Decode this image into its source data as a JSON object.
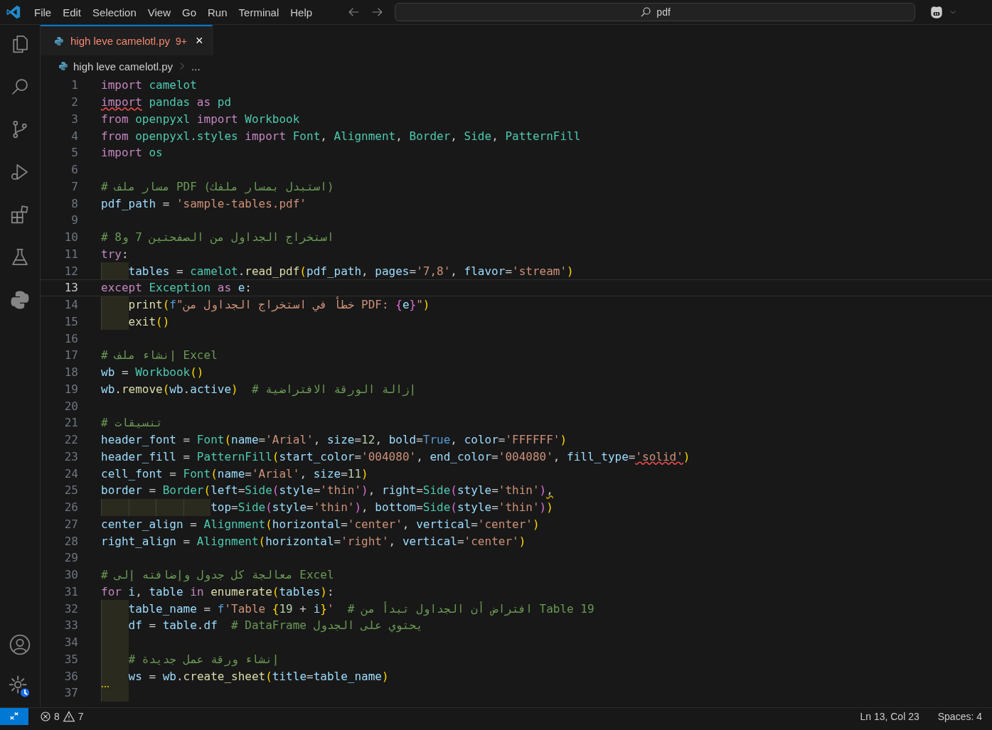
{
  "menu": [
    "File",
    "Edit",
    "Selection",
    "View",
    "Go",
    "Run",
    "Terminal",
    "Help"
  ],
  "search": {
    "value": "pdf"
  },
  "tabs": [
    {
      "label": "high leve camelotl.py",
      "problems": "9+",
      "close": "×",
      "selected": true,
      "has_errors": true
    }
  ],
  "breadcrumb": {
    "file": "high leve camelotl.py",
    "more": "..."
  },
  "lines": [
    {
      "number": "1",
      "current": false,
      "tokens": [
        {
          "kind": "kw",
          "text": "import"
        },
        {
          "kind": "mod",
          "text": " camelot"
        }
      ]
    },
    {
      "number": "2",
      "current": false,
      "tokens": [
        {
          "kind": "kw",
          "text": "import",
          "error": true
        },
        {
          "kind": "mod",
          "text": " pandas"
        },
        {
          "kind": "kw",
          "text": " as"
        },
        {
          "kind": "mod",
          "text": " pd"
        }
      ]
    },
    {
      "number": "3",
      "current": false,
      "tokens": [
        {
          "kind": "kw",
          "text": "from"
        },
        {
          "kind": "mod",
          "text": " openpyxl"
        },
        {
          "kind": "kw",
          "text": " import"
        },
        {
          "kind": "mod",
          "text": " Workbook"
        }
      ]
    },
    {
      "number": "4",
      "current": false,
      "tokens": [
        {
          "kind": "kw",
          "text": "from"
        },
        {
          "kind": "mod",
          "text": " openpyxl.styles"
        },
        {
          "kind": "kw",
          "text": " import"
        },
        {
          "kind": "mod",
          "text": " Font"
        },
        {
          "kind": "op",
          "text": ","
        },
        {
          "kind": "mod",
          "text": " Alignment"
        },
        {
          "kind": "op",
          "text": ","
        },
        {
          "kind": "mod",
          "text": " Border"
        },
        {
          "kind": "op",
          "text": ","
        },
        {
          "kind": "mod",
          "text": " Side"
        },
        {
          "kind": "op",
          "text": ","
        },
        {
          "kind": "mod",
          "text": " PatternFill"
        }
      ]
    },
    {
      "number": "5",
      "current": false,
      "tokens": [
        {
          "kind": "kw",
          "text": "import"
        },
        {
          "kind": "mod",
          "text": " os"
        }
      ]
    },
    {
      "number": "6",
      "current": false
    },
    {
      "number": "7",
      "current": false,
      "tokens": [
        {
          "kind": "cmt",
          "text": "# مسار ملف PDF (استبدل بمسار ملفك)"
        }
      ]
    },
    {
      "number": "8",
      "current": false,
      "tokens": [
        {
          "kind": "var",
          "text": "pdf_path"
        },
        {
          "kind": "op",
          "text": " ="
        },
        {
          "kind": "str",
          "text": " 'sample-tables.pdf'"
        }
      ]
    },
    {
      "number": "9",
      "current": false
    },
    {
      "number": "10",
      "current": false,
      "tokens": [
        {
          "kind": "cmt",
          "text": "# استخراج الجداول من الصفحتين 7 و8"
        }
      ]
    },
    {
      "number": "11",
      "current": false,
      "tokens": [
        {
          "kind": "kw",
          "text": "try"
        },
        {
          "kind": "op",
          "text": ":"
        }
      ]
    },
    {
      "number": "12",
      "current": false,
      "tokens": [
        {
          "kind": "indent"
        },
        {
          "kind": "var",
          "text": "tables"
        },
        {
          "kind": "op",
          "text": " ="
        },
        {
          "kind": "mod",
          "text": " camelot"
        },
        {
          "kind": "op",
          "text": "."
        },
        {
          "kind": "fn",
          "text": "read_pdf"
        },
        {
          "kind": "br1",
          "text": "("
        },
        {
          "kind": "var",
          "text": "pdf_path"
        },
        {
          "kind": "op",
          "text": ","
        },
        {
          "kind": "var",
          "text": " pages"
        },
        {
          "kind": "op",
          "text": "="
        },
        {
          "kind": "str",
          "text": "'7,8'"
        },
        {
          "kind": "op",
          "text": ","
        },
        {
          "kind": "var",
          "text": " flavor"
        },
        {
          "kind": "op",
          "text": "="
        },
        {
          "kind": "str",
          "text": "'stream'"
        },
        {
          "kind": "br1",
          "text": ")"
        }
      ]
    },
    {
      "number": "13",
      "current": true,
      "tokens": [
        {
          "kind": "kw",
          "text": "except"
        },
        {
          "kind": "mod",
          "text": " Exception"
        },
        {
          "kind": "kw",
          "text": " as"
        },
        {
          "kind": "var",
          "text": " e"
        },
        {
          "kind": "op",
          "text": ":"
        }
      ]
    },
    {
      "number": "14",
      "current": false,
      "tokens": [
        {
          "kind": "indent"
        },
        {
          "kind": "fn",
          "text": "print"
        },
        {
          "kind": "br1",
          "text": "("
        },
        {
          "kind": "const",
          "text": "f"
        },
        {
          "kind": "str",
          "text": "\"خطأ في استخراج الجداول من PDF: "
        },
        {
          "kind": "br2",
          "text": "{"
        },
        {
          "kind": "var",
          "text": "e"
        },
        {
          "kind": "br2",
          "text": "}"
        },
        {
          "kind": "str",
          "text": "\""
        },
        {
          "kind": "br1",
          "text": ")"
        }
      ]
    },
    {
      "number": "15",
      "current": false,
      "tokens": [
        {
          "kind": "indent"
        },
        {
          "kind": "fn",
          "text": "exit"
        },
        {
          "kind": "br1",
          "text": "()"
        }
      ]
    },
    {
      "number": "16",
      "current": false
    },
    {
      "number": "17",
      "current": false,
      "tokens": [
        {
          "kind": "cmt",
          "text": "# إنشاء ملف Excel"
        }
      ]
    },
    {
      "number": "18",
      "current": false,
      "tokens": [
        {
          "kind": "var",
          "text": "wb"
        },
        {
          "kind": "op",
          "text": " ="
        },
        {
          "kind": "mod",
          "text": " Workbook"
        },
        {
          "kind": "br1",
          "text": "()"
        }
      ]
    },
    {
      "number": "19",
      "current": false,
      "tokens": [
        {
          "kind": "var",
          "text": "wb"
        },
        {
          "kind": "op",
          "text": "."
        },
        {
          "kind": "fn",
          "text": "remove"
        },
        {
          "kind": "br1",
          "text": "("
        },
        {
          "kind": "var",
          "text": "wb"
        },
        {
          "kind": "op",
          "text": "."
        },
        {
          "kind": "var",
          "text": "active"
        },
        {
          "kind": "br1",
          "text": ")"
        },
        {
          "kind": "cmt",
          "text": "  # إزالة الورقة الافتراضية"
        }
      ]
    },
    {
      "number": "20",
      "current": false
    },
    {
      "number": "21",
      "current": false,
      "tokens": [
        {
          "kind": "cmt",
          "text": "# تنسيقات"
        }
      ]
    },
    {
      "number": "22",
      "current": false,
      "tokens": [
        {
          "kind": "var",
          "text": "header_font"
        },
        {
          "kind": "op",
          "text": " ="
        },
        {
          "kind": "mod",
          "text": " Font"
        },
        {
          "kind": "br1",
          "text": "("
        },
        {
          "kind": "var",
          "text": "name"
        },
        {
          "kind": "op",
          "text": "="
        },
        {
          "kind": "str",
          "text": "'Arial'"
        },
        {
          "kind": "op",
          "text": ","
        },
        {
          "kind": "var",
          "text": " size"
        },
        {
          "kind": "op",
          "text": "="
        },
        {
          "kind": "num",
          "text": "12"
        },
        {
          "kind": "op",
          "text": ","
        },
        {
          "kind": "var",
          "text": " bold"
        },
        {
          "kind": "op",
          "text": "="
        },
        {
          "kind": "const",
          "text": "True"
        },
        {
          "kind": "op",
          "text": ","
        },
        {
          "kind": "var",
          "text": " color"
        },
        {
          "kind": "op",
          "text": "="
        },
        {
          "kind": "str",
          "text": "'FFFFFF'"
        },
        {
          "kind": "br1",
          "text": ")"
        }
      ]
    },
    {
      "number": "23",
      "current": false,
      "tokens": [
        {
          "kind": "var",
          "text": "header_fill"
        },
        {
          "kind": "op",
          "text": " ="
        },
        {
          "kind": "mod",
          "text": " PatternFill"
        },
        {
          "kind": "br1",
          "text": "("
        },
        {
          "kind": "var",
          "text": "start_color"
        },
        {
          "kind": "op",
          "text": "="
        },
        {
          "kind": "str",
          "text": "'004080'"
        },
        {
          "kind": "op",
          "text": ","
        },
        {
          "kind": "var",
          "text": " end_color"
        },
        {
          "kind": "op",
          "text": "="
        },
        {
          "kind": "str",
          "text": "'004080'"
        },
        {
          "kind": "op",
          "text": ","
        },
        {
          "kind": "var",
          "text": " fill_type"
        },
        {
          "kind": "op",
          "text": "="
        },
        {
          "kind": "str",
          "text": "'solid'",
          "error": true
        },
        {
          "kind": "br1",
          "text": ")"
        }
      ]
    },
    {
      "number": "24",
      "current": false,
      "tokens": [
        {
          "kind": "var",
          "text": "cell_font"
        },
        {
          "kind": "op",
          "text": " ="
        },
        {
          "kind": "mod",
          "text": " Font"
        },
        {
          "kind": "br1",
          "text": "("
        },
        {
          "kind": "var",
          "text": "name"
        },
        {
          "kind": "op",
          "text": "="
        },
        {
          "kind": "str",
          "text": "'Arial'"
        },
        {
          "kind": "op",
          "text": ","
        },
        {
          "kind": "var",
          "text": " size"
        },
        {
          "kind": "op",
          "text": "="
        },
        {
          "kind": "num",
          "text": "11"
        },
        {
          "kind": "br1",
          "text": ")"
        }
      ]
    },
    {
      "number": "25",
      "current": false,
      "tokens": [
        {
          "kind": "var",
          "text": "border"
        },
        {
          "kind": "op",
          "text": " ="
        },
        {
          "kind": "mod",
          "text": " Border"
        },
        {
          "kind": "br1",
          "text": "("
        },
        {
          "kind": "var",
          "text": "left"
        },
        {
          "kind": "op",
          "text": "="
        },
        {
          "kind": "mod",
          "text": "Side"
        },
        {
          "kind": "br2",
          "text": "("
        },
        {
          "kind": "var",
          "text": "style"
        },
        {
          "kind": "op",
          "text": "="
        },
        {
          "kind": "str",
          "text": "'thin'"
        },
        {
          "kind": "br2",
          "text": ")"
        },
        {
          "kind": "op",
          "text": ","
        },
        {
          "kind": "var",
          "text": " right"
        },
        {
          "kind": "op",
          "text": "="
        },
        {
          "kind": "mod",
          "text": "Side"
        },
        {
          "kind": "br2",
          "text": "("
        },
        {
          "kind": "var",
          "text": "style"
        },
        {
          "kind": "op",
          "text": "="
        },
        {
          "kind": "str",
          "text": "'thin'"
        },
        {
          "kind": "br2",
          "text": ")"
        },
        {
          "kind": "op",
          "text": ",",
          "warning": true
        }
      ]
    },
    {
      "number": "26",
      "current": false,
      "tokens": [
        {
          "kind": "indent"
        },
        {
          "kind": "indent"
        },
        {
          "kind": "indent"
        },
        {
          "kind": "indent"
        },
        {
          "kind": "var",
          "text": "top"
        },
        {
          "kind": "op",
          "text": "="
        },
        {
          "kind": "mod",
          "text": "Side"
        },
        {
          "kind": "br2",
          "text": "("
        },
        {
          "kind": "var",
          "text": "style"
        },
        {
          "kind": "op",
          "text": "="
        },
        {
          "kind": "str",
          "text": "'thin'"
        },
        {
          "kind": "br2",
          "text": ")"
        },
        {
          "kind": "op",
          "text": ","
        },
        {
          "kind": "var",
          "text": " bottom"
        },
        {
          "kind": "op",
          "text": "="
        },
        {
          "kind": "mod",
          "text": "Side"
        },
        {
          "kind": "br2",
          "text": "("
        },
        {
          "kind": "var",
          "text": "style"
        },
        {
          "kind": "op",
          "text": "="
        },
        {
          "kind": "str",
          "text": "'thin'"
        },
        {
          "kind": "br2",
          "text": ")"
        },
        {
          "kind": "br1",
          "text": ")"
        }
      ]
    },
    {
      "number": "27",
      "current": false,
      "tokens": [
        {
          "kind": "var",
          "text": "center_align"
        },
        {
          "kind": "op",
          "text": " ="
        },
        {
          "kind": "mod",
          "text": " Alignment"
        },
        {
          "kind": "br1",
          "text": "("
        },
        {
          "kind": "var",
          "text": "horizontal"
        },
        {
          "kind": "op",
          "text": "="
        },
        {
          "kind": "str",
          "text": "'center'"
        },
        {
          "kind": "op",
          "text": ","
        },
        {
          "kind": "var",
          "text": " vertical"
        },
        {
          "kind": "op",
          "text": "="
        },
        {
          "kind": "str",
          "text": "'center'"
        },
        {
          "kind": "br1",
          "text": ")"
        }
      ]
    },
    {
      "number": "28",
      "current": false,
      "tokens": [
        {
          "kind": "var",
          "text": "right_align"
        },
        {
          "kind": "op",
          "text": " ="
        },
        {
          "kind": "mod",
          "text": " Alignment"
        },
        {
          "kind": "br1",
          "text": "("
        },
        {
          "kind": "var",
          "text": "horizontal"
        },
        {
          "kind": "op",
          "text": "="
        },
        {
          "kind": "str",
          "text": "'right'"
        },
        {
          "kind": "op",
          "text": ","
        },
        {
          "kind": "var",
          "text": " vertical"
        },
        {
          "kind": "op",
          "text": "="
        },
        {
          "kind": "str",
          "text": "'center'"
        },
        {
          "kind": "br1",
          "text": ")"
        }
      ]
    },
    {
      "number": "29",
      "current": false
    },
    {
      "number": "30",
      "current": false,
      "tokens": [
        {
          "kind": "cmt",
          "text": "# معالجة كل جدول وإضافته إلى Excel"
        }
      ]
    },
    {
      "number": "31",
      "current": false,
      "tokens": [
        {
          "kind": "kw",
          "text": "for"
        },
        {
          "kind": "var",
          "text": " i"
        },
        {
          "kind": "op",
          "text": ","
        },
        {
          "kind": "var",
          "text": " table"
        },
        {
          "kind": "kw",
          "text": " in"
        },
        {
          "kind": "fn",
          "text": " enumerate"
        },
        {
          "kind": "br1",
          "text": "("
        },
        {
          "kind": "var",
          "text": "tables"
        },
        {
          "kind": "br1",
          "text": ")"
        },
        {
          "kind": "op",
          "text": ":"
        }
      ]
    },
    {
      "number": "32",
      "current": false,
      "tokens": [
        {
          "kind": "indent"
        },
        {
          "kind": "var",
          "text": "table_name"
        },
        {
          "kind": "op",
          "text": " ="
        },
        {
          "kind": "const",
          "text": " f"
        },
        {
          "kind": "str",
          "text": "'Table "
        },
        {
          "kind": "br1",
          "text": "{"
        },
        {
          "kind": "num",
          "text": "19"
        },
        {
          "kind": "op",
          "text": " +"
        },
        {
          "kind": "var",
          "text": " i"
        },
        {
          "kind": "br1",
          "text": "}"
        },
        {
          "kind": "str",
          "text": "'"
        },
        {
          "kind": "cmt",
          "text": "  # افتراض أن الجداول تبدأ من Table 19"
        }
      ]
    },
    {
      "number": "33",
      "current": false,
      "tokens": [
        {
          "kind": "indent"
        },
        {
          "kind": "var",
          "text": "df"
        },
        {
          "kind": "op",
          "text": " ="
        },
        {
          "kind": "var",
          "text": " table"
        },
        {
          "kind": "op",
          "text": "."
        },
        {
          "kind": "var",
          "text": "df"
        },
        {
          "kind": "cmt",
          "text": "  # DataFrame يحتوي على الجدول"
        }
      ]
    },
    {
      "number": "34",
      "current": false,
      "tokens": [
        {
          "kind": "indent"
        }
      ]
    },
    {
      "number": "35",
      "current": false,
      "tokens": [
        {
          "kind": "indent"
        },
        {
          "kind": "cmt",
          "text": "# إنشاء ورقة عمل جديدة"
        }
      ]
    },
    {
      "number": "36",
      "current": false,
      "tokens": [
        {
          "kind": "indent"
        },
        {
          "kind": "var",
          "text": "ws"
        },
        {
          "kind": "op",
          "text": " ="
        },
        {
          "kind": "var",
          "text": " wb"
        },
        {
          "kind": "op",
          "text": "."
        },
        {
          "kind": "fn",
          "text": "create_sheet"
        },
        {
          "kind": "br1",
          "text": "("
        },
        {
          "kind": "var",
          "text": "title"
        },
        {
          "kind": "op",
          "text": "="
        },
        {
          "kind": "var",
          "text": "table_name"
        },
        {
          "kind": "br1",
          "text": ")"
        }
      ]
    },
    {
      "number": "37",
      "current": false,
      "tokens": [
        {
          "kind": "indent",
          "warning": true
        }
      ]
    }
  ],
  "status_bar": {
    "errors": "8",
    "warnings": "7",
    "position": "Ln 13, Col 23",
    "indentation": "Spaces: 4"
  }
}
